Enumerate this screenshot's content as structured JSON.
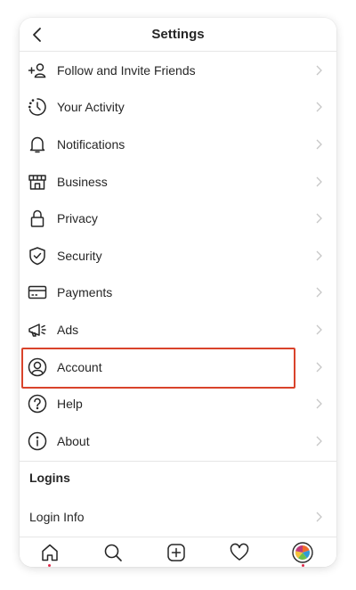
{
  "header": {
    "title": "Settings"
  },
  "menu": [
    {
      "label": "Follow and Invite Friends",
      "icon": "add-person-icon"
    },
    {
      "label": "Your Activity",
      "icon": "activity-icon"
    },
    {
      "label": "Notifications",
      "icon": "bell-icon"
    },
    {
      "label": "Business",
      "icon": "store-icon"
    },
    {
      "label": "Privacy",
      "icon": "lock-icon"
    },
    {
      "label": "Security",
      "icon": "shield-check-icon"
    },
    {
      "label": "Payments",
      "icon": "card-icon"
    },
    {
      "label": "Ads",
      "icon": "megaphone-icon"
    },
    {
      "label": "Account",
      "icon": "account-circle-icon"
    },
    {
      "label": "Help",
      "icon": "help-icon"
    },
    {
      "label": "About",
      "icon": "info-icon"
    }
  ],
  "logins": {
    "section_title": "Logins",
    "login_info_label": "Login Info"
  },
  "tabbar": {
    "items": [
      "home-icon",
      "search-icon",
      "new-post-icon",
      "heart-icon",
      "profile-avatar-icon"
    ]
  },
  "colors": {
    "highlight": "#d9432b",
    "text": "#262626",
    "chevron": "#c7c7c7",
    "notification_dot": "#e0294a"
  }
}
